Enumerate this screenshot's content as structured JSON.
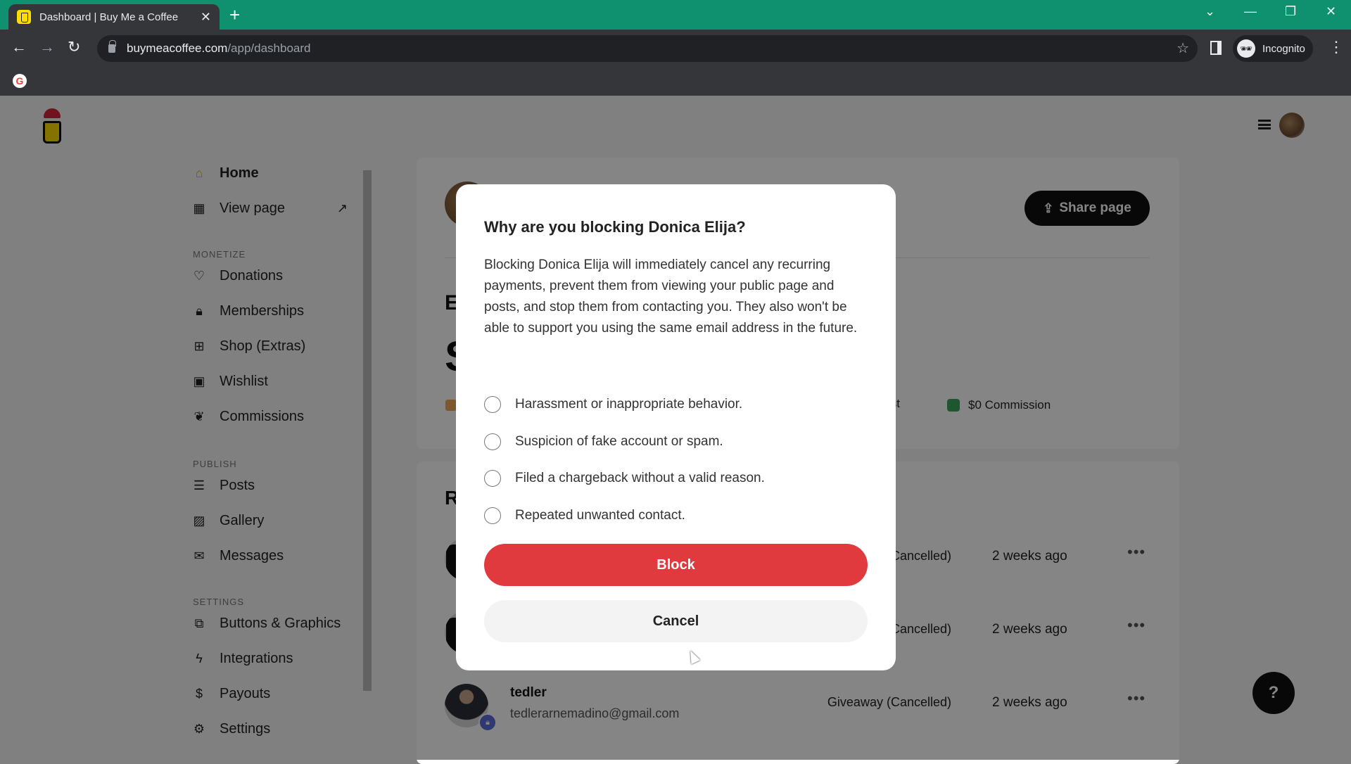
{
  "browser": {
    "tab_title": "Dashboard | Buy Me a Coffee",
    "tab_close": "✕",
    "new_tab": "+",
    "url_host": "buymeacoffee.com",
    "url_path": "/app/dashboard",
    "profile_label": "Incognito",
    "window_controls": {
      "dropdown": "⌄",
      "minimize": "—",
      "restore": "❐",
      "close": "✕"
    },
    "nav": {
      "back": "←",
      "forward": "→",
      "reload": "↻"
    },
    "bookmark_star": "☆",
    "menu": "⋮"
  },
  "sidebar": {
    "items_top": [
      {
        "label": "Home",
        "icon": "home-icon"
      },
      {
        "label": "View page",
        "icon": "layout-icon"
      }
    ],
    "sections": [
      {
        "title": "MONETIZE",
        "items": [
          {
            "label": "Donations",
            "icon": "heart-icon"
          },
          {
            "label": "Memberships",
            "icon": "lock-icon"
          },
          {
            "label": "Shop (Extras)",
            "icon": "gift-icon"
          },
          {
            "label": "Wishlist",
            "icon": "wishlist-icon"
          },
          {
            "label": "Commissions",
            "icon": "handshake-icon"
          }
        ]
      },
      {
        "title": "PUBLISH",
        "items": [
          {
            "label": "Posts",
            "icon": "document-icon"
          },
          {
            "label": "Gallery",
            "icon": "image-icon"
          },
          {
            "label": "Messages",
            "icon": "mail-icon"
          }
        ]
      },
      {
        "title": "SETTINGS",
        "items": [
          {
            "label": "Buttons & Graphics",
            "icon": "code-window-icon"
          },
          {
            "label": "Integrations",
            "icon": "lightning-icon"
          },
          {
            "label": "Payouts",
            "icon": "dollar-icon"
          },
          {
            "label": "Settings",
            "icon": "gear-icon"
          }
        ]
      }
    ]
  },
  "dashboard": {
    "share_label": "Share page",
    "earnings_heading_partial": "E",
    "earnings_amount_partial": "S",
    "legend_partial": "ist",
    "legend_commission": "$0 Commission",
    "recent_heading_partial": "R",
    "rows": [
      {
        "name": "",
        "email": "",
        "type": "Cancelled)",
        "time": "2 weeks ago",
        "more": "•••"
      },
      {
        "name": "",
        "email": "",
        "type": "Cancelled)",
        "time": "2 weeks ago",
        "more": "•••"
      },
      {
        "name": "tedler",
        "email": "tedlerarnemadino@gmail.com",
        "type": "Giveaway (Cancelled)",
        "time": "2 weeks ago",
        "more": "•••"
      }
    ],
    "help": "?"
  },
  "modal": {
    "title": "Why are you blocking Donica Elija?",
    "body": "Blocking Donica Elija will immediately cancel any recurring payments, prevent them from viewing your public page and posts, and stop them from contacting you. They also won't be able to support you using the same email address in the future.",
    "reasons": [
      {
        "label": "Harassment or inappropriate behavior.",
        "selected": false
      },
      {
        "label": "Suspicion of fake account or spam.",
        "selected": false
      },
      {
        "label": "Filed a chargeback without a valid reason.",
        "selected": false
      },
      {
        "label": "Repeated unwanted contact.",
        "selected": false
      }
    ],
    "block_label": "Block",
    "cancel_label": "Cancel",
    "block_color": "#e0393e"
  }
}
